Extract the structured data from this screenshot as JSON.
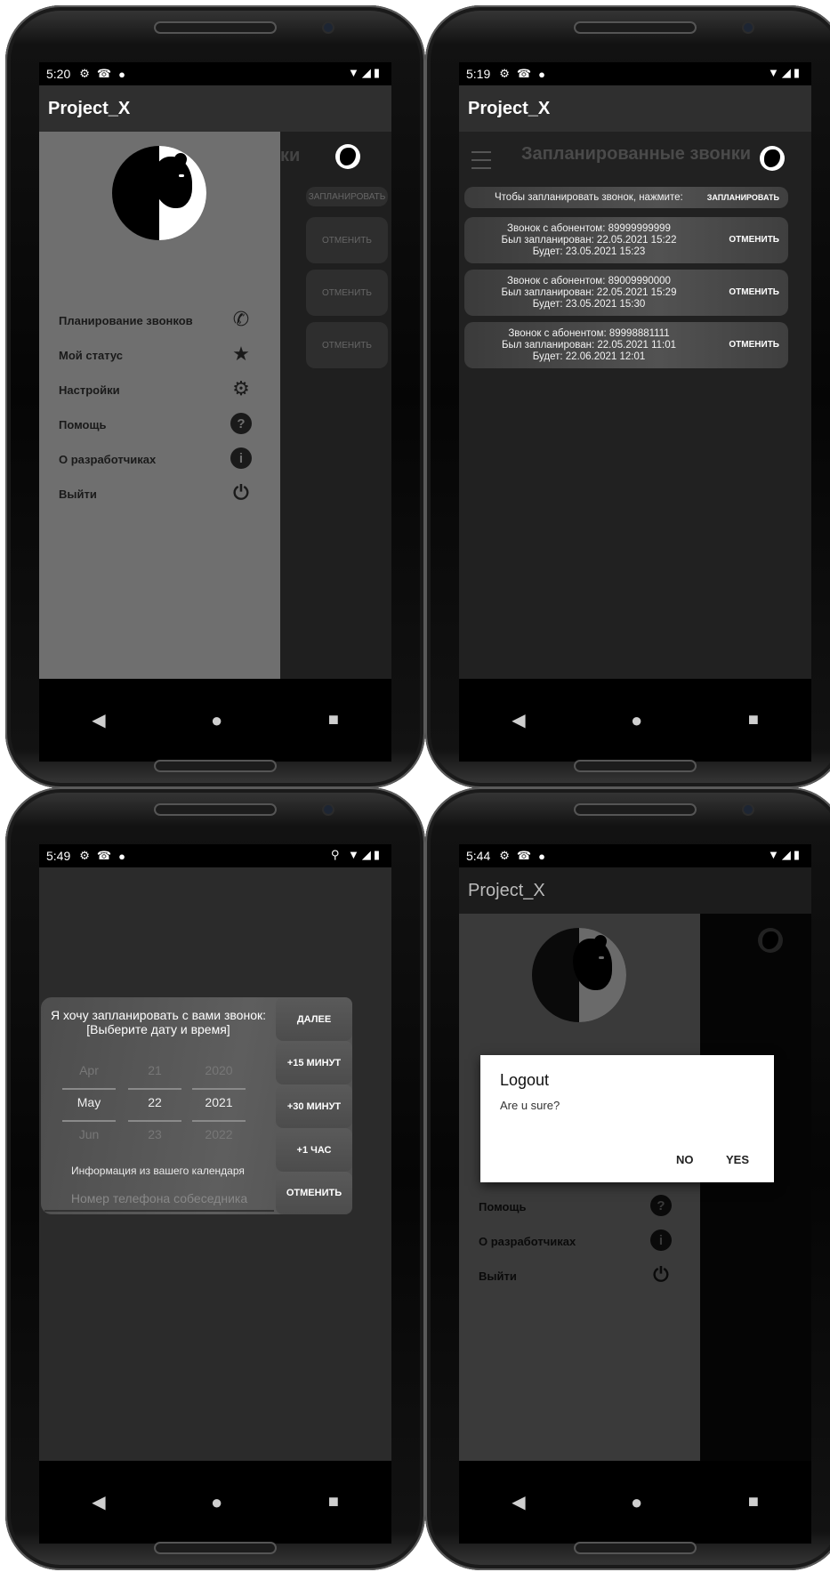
{
  "colors": {
    "accent": "#ffffff",
    "drawer": "#6f6f6f",
    "background": "#212121"
  },
  "icons": [
    "phone-icon",
    "star-icon",
    "gear-icon",
    "help-icon",
    "info-icon",
    "power-icon",
    "back-icon",
    "home-icon",
    "recents-icon"
  ],
  "nav": {
    "back": "◀",
    "home": "●",
    "recents": "■"
  },
  "phone1": {
    "status": {
      "time": "5:20",
      "right": "▼◢▮"
    },
    "app_title": "Project_X",
    "menu": [
      {
        "label": "Планирование звонков",
        "icon": "phone-icon",
        "glyph": "✆"
      },
      {
        "label": "Мой статус",
        "icon": "star-icon",
        "glyph": "★"
      },
      {
        "label": "Настройки",
        "icon": "gear-icon",
        "glyph": "⚙"
      },
      {
        "label": "Помощь",
        "icon": "help-icon",
        "glyph": "?"
      },
      {
        "label": "О разработчиках",
        "icon": "info-icon",
        "glyph": "i"
      },
      {
        "label": "Выйти",
        "icon": "power-icon",
        "glyph": "⏻"
      }
    ],
    "behind": {
      "title_fragment": "ки",
      "schedule": "ЗАПЛАНИРОВАТЬ",
      "cancel": "ОТМЕНИТЬ"
    }
  },
  "phone2": {
    "status": {
      "time": "5:19",
      "right": "▼◢▮"
    },
    "app_title": "Project_X",
    "screen_title": "Запланированные звонки",
    "hint": "Чтобы запланировать звонок, нажмите:",
    "schedule_btn": "ЗАПЛАНИРОВАТЬ",
    "calls": [
      {
        "line1": "Звонок с абонентом: 89999999999",
        "line2": "Был запланирован: 22.05.2021 15:22",
        "line3": "Будет: 23.05.2021 15:23",
        "action": "ОТМЕНИТЬ"
      },
      {
        "line1": "Звонок с абонентом: 89009990000",
        "line2": "Был запланирован: 22.05.2021 15:29",
        "line3": "Будет: 23.05.2021 15:30",
        "action": "ОТМЕНИТЬ"
      },
      {
        "line1": "Звонок с абонентом: 89998881111",
        "line2": "Был запланирован: 22.05.2021 11:01",
        "line3": "Будет: 22.06.2021 12:01",
        "action": "ОТМЕНИТЬ"
      }
    ]
  },
  "phone3": {
    "status": {
      "time": "5:49",
      "right": "⚲ ▼◢▮"
    },
    "dialog_line1": "Я хочу запланировать с вами звонок:",
    "dialog_line2": "[Выберите дату и время]",
    "picker": {
      "months": [
        "Apr",
        "May",
        "Jun"
      ],
      "days": [
        "21",
        "22",
        "23"
      ],
      "years": [
        "2020",
        "2021",
        "2022"
      ]
    },
    "calendar_info": "Информация из вашего календаря",
    "phone_placeholder": "Номер телефона собеседника",
    "buttons": {
      "next": "ДАЛЕЕ",
      "plus15": "+15 МИНУТ",
      "plus30": "+30 МИНУТ",
      "plus1h": "+1 ЧАС",
      "cancel": "ОТМЕНИТЬ"
    }
  },
  "phone4": {
    "status": {
      "time": "5:44",
      "right": "▼◢▮"
    },
    "app_title": "Project_X",
    "menu_visible": [
      {
        "label": "Помощь",
        "glyph": "?"
      },
      {
        "label": "О разработчиках",
        "glyph": "i"
      },
      {
        "label": "Выйти",
        "glyph": "⏻"
      }
    ],
    "dialog": {
      "title": "Logout",
      "message": "Are u sure?",
      "no": "NO",
      "yes": "YES"
    }
  }
}
